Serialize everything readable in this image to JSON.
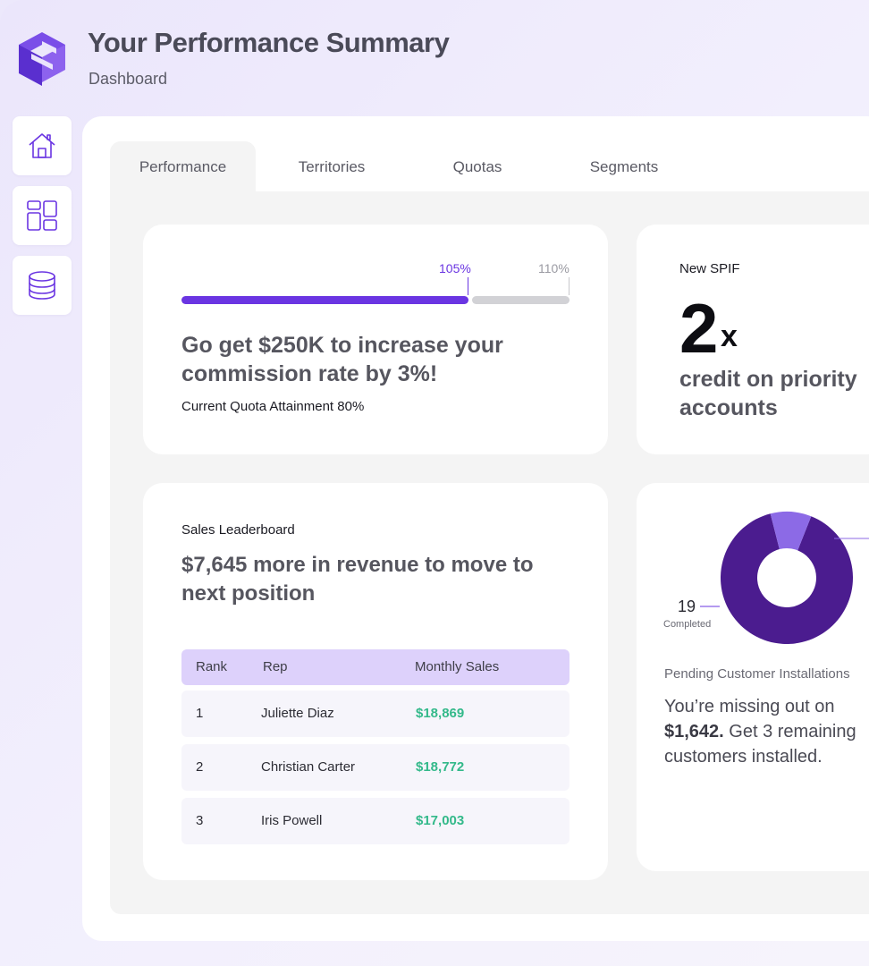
{
  "header": {
    "title": "Your Performance Summary",
    "subtitle": "Dashboard"
  },
  "sidebar": {
    "items": [
      {
        "name": "home",
        "icon": "home-icon"
      },
      {
        "name": "layout",
        "icon": "layout-grid-icon"
      },
      {
        "name": "database",
        "icon": "database-icon"
      }
    ]
  },
  "tabs": [
    {
      "label": "Performance",
      "active": true
    },
    {
      "label": "Territories",
      "active": false
    },
    {
      "label": "Quotas",
      "active": false
    },
    {
      "label": "Segments",
      "active": false
    }
  ],
  "quota_card": {
    "marker_current_label": "105%",
    "marker_next_label": "110%",
    "progress": 0.74,
    "headline_line1": "Go get $250K to increase your",
    "headline_line2": "commission rate by 3%!",
    "attainment": "Current Quota Attainment 80%"
  },
  "spif_card": {
    "label": "New SPIF",
    "multiplier": "2",
    "multiplier_suffix": "x",
    "desc_line1": "credit on priority",
    "desc_line2": "accounts"
  },
  "leaderboard": {
    "label": "Sales Leaderboard",
    "headline_line1": "$7,645 more in revenue to move to",
    "headline_line2": "next position",
    "columns": [
      "Rank",
      "Rep",
      "Monthly Sales"
    ],
    "rows": [
      {
        "rank": "1",
        "rep": "Juliette Diaz",
        "sales": "$18,869"
      },
      {
        "rank": "2",
        "rep": "Christian Carter",
        "sales": "$18,772"
      },
      {
        "rank": "3",
        "rep": "Iris Powell",
        "sales": "$17,003"
      }
    ]
  },
  "installs_card": {
    "completed_count": "19",
    "completed_label": "Completed",
    "completed_fraction": 0.9,
    "pending_label": "Pending Customer Installations",
    "missing_line1": "You’re missing out on",
    "missing_amount": "$1,642.",
    "missing_rest": " Get 3 remaining",
    "missing_line3": "customers installed."
  },
  "colors": {
    "accent": "#6a35e2",
    "donut_dark": "#4b1c8f",
    "donut_light": "#8c6ae6",
    "sales_green": "#33b98a",
    "table_head": "#ddd1fb"
  }
}
